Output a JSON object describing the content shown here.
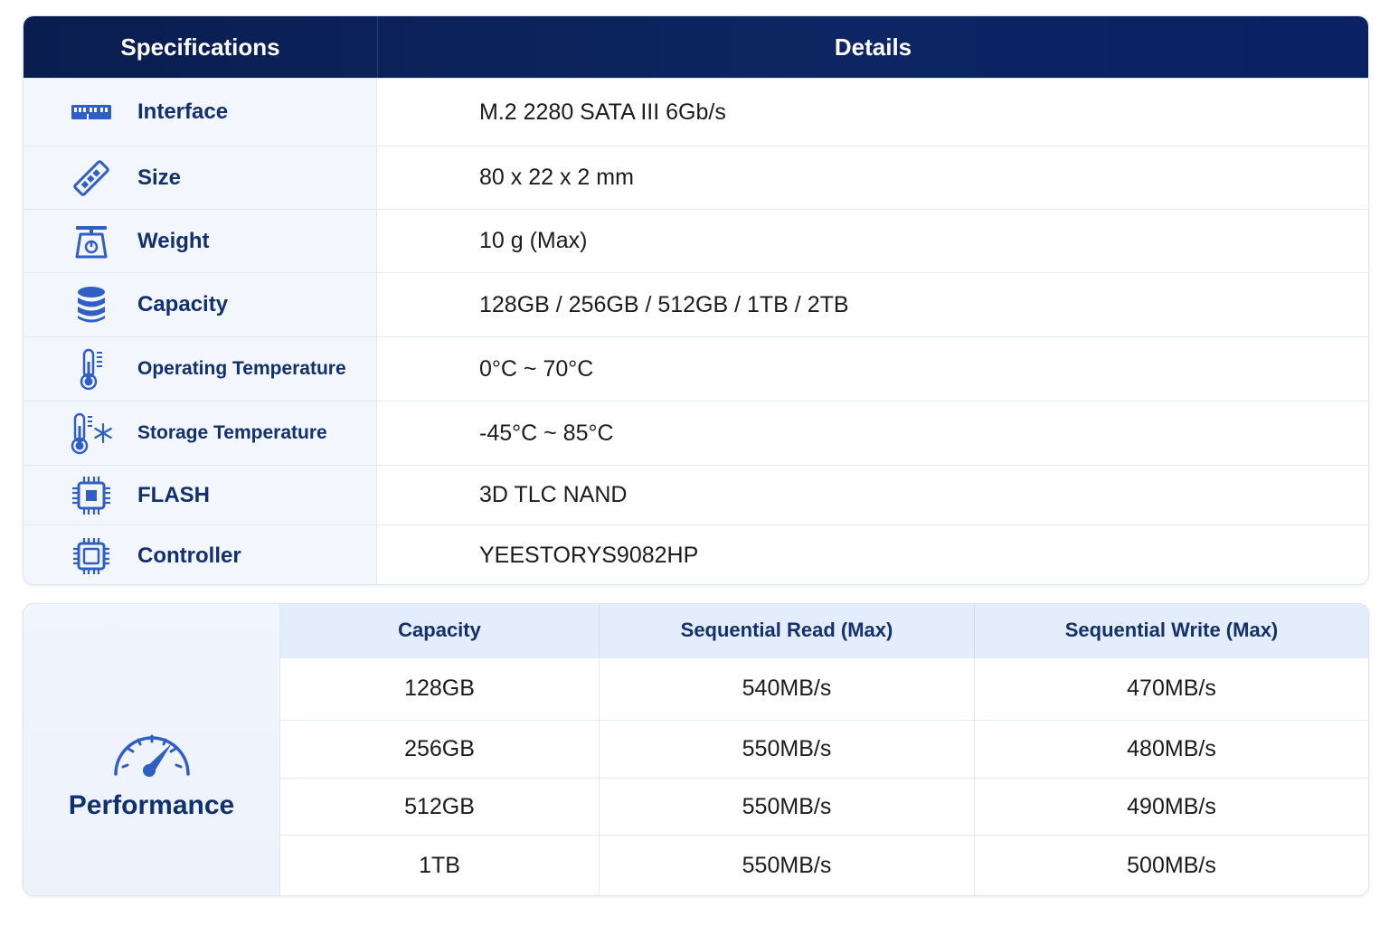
{
  "spec_table": {
    "header": {
      "left": "Specifications",
      "right": "Details"
    },
    "rows": [
      {
        "icon": "m2-interface-icon",
        "label": "Interface",
        "value": "M.2 2280 SATA III 6Gb/s"
      },
      {
        "icon": "ssd-stick-icon",
        "label": "Size",
        "value": "80 x 22 x 2 mm"
      },
      {
        "icon": "scale-icon",
        "label": "Weight",
        "value": "10 g (Max)"
      },
      {
        "icon": "database-icon",
        "label": "Capacity",
        "value": "128GB / 256GB / 512GB / 1TB / 2TB"
      },
      {
        "icon": "thermometer-icon",
        "label": "Operating Temperature",
        "value": "0°C ~ 70°C"
      },
      {
        "icon": "thermometer-snowflake-icon",
        "label": "Storage Temperature",
        "value": "-45°C ~ 85°C"
      },
      {
        "icon": "flash-chip-icon",
        "label": "FLASH",
        "value": "3D TLC NAND"
      },
      {
        "icon": "controller-chip-icon",
        "label": "Controller",
        "value": "YEESTORYS9082HP"
      }
    ]
  },
  "performance": {
    "title": "Performance",
    "icon": "speedometer-icon",
    "columns": [
      "Capacity",
      "Sequential Read (Max)",
      "Sequential Write (Max)"
    ],
    "rows": [
      [
        "128GB",
        "540MB/s",
        "470MB/s"
      ],
      [
        "256GB",
        "550MB/s",
        "480MB/s"
      ],
      [
        "512GB",
        "550MB/s",
        "490MB/s"
      ],
      [
        "1TB",
        "550MB/s",
        "500MB/s"
      ]
    ]
  },
  "colors": {
    "header_bg": "#0a1d4f",
    "label_text": "#11306e",
    "icon_blue": "#2f5fc4"
  }
}
